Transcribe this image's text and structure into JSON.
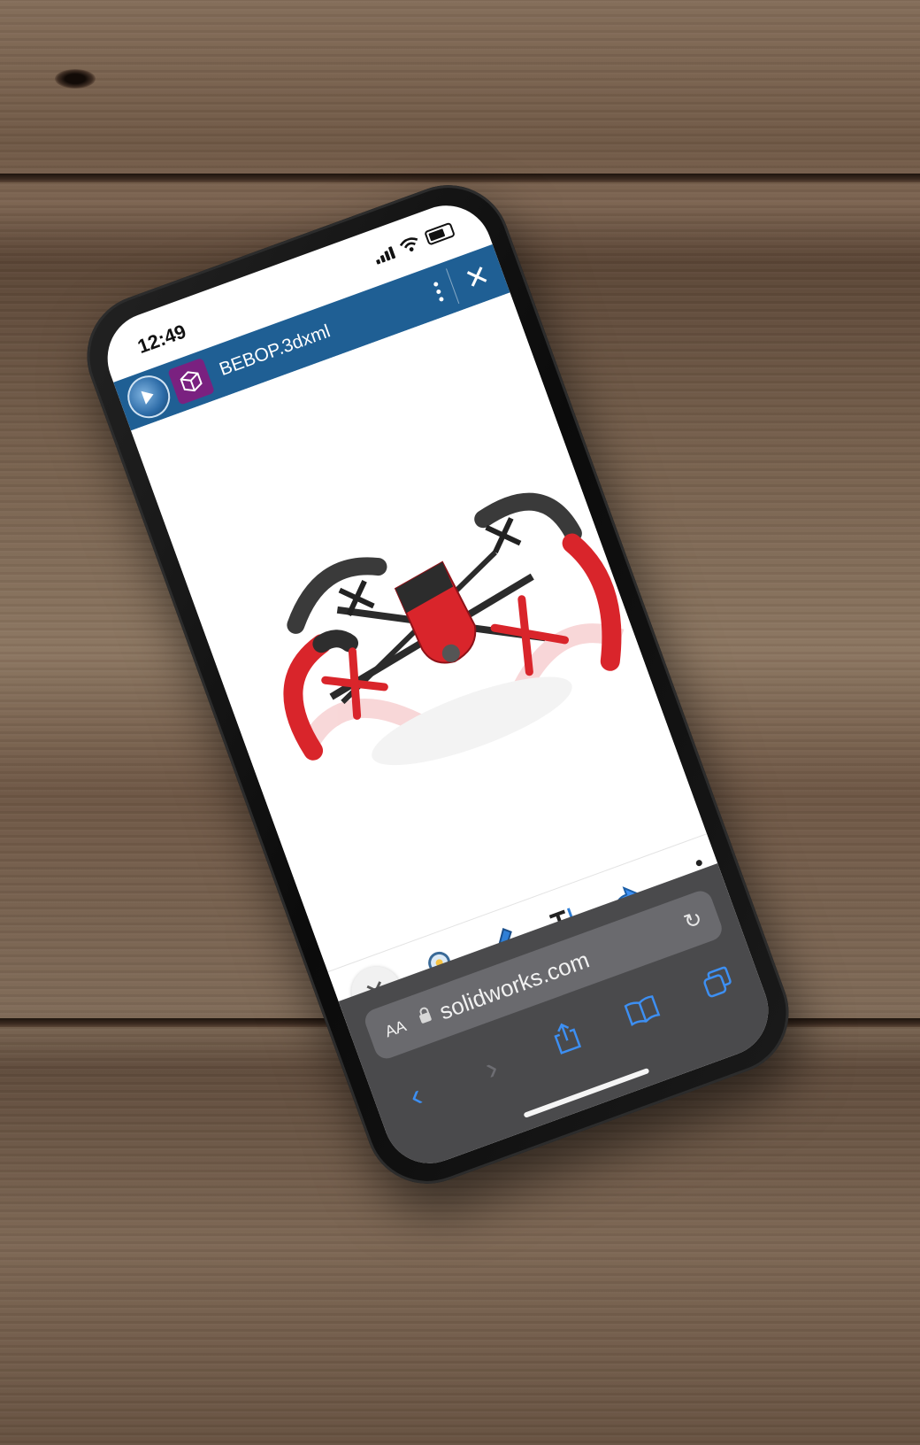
{
  "status_bar": {
    "time": "12:49"
  },
  "app_header": {
    "title": "BEBOP.3dxml",
    "close_label": "✕",
    "accent_color": "#1f5f94",
    "badge_color": "#7a2180"
  },
  "viewer": {
    "model_name": "Parrot Bebop drone",
    "model_color": "#d9252b"
  },
  "toolbar": {
    "close_label": "✕",
    "tools": [
      "close-icon",
      "magnifier-icon",
      "pencil-icon",
      "text-icon",
      "share-arrow-icon",
      "more-icon"
    ]
  },
  "safari": {
    "text_size_label": "AA",
    "url": "solidworks.com",
    "reload_label": "↻",
    "back_label": "‹",
    "forward_label": "›",
    "tint_color": "#3d8ff2"
  }
}
